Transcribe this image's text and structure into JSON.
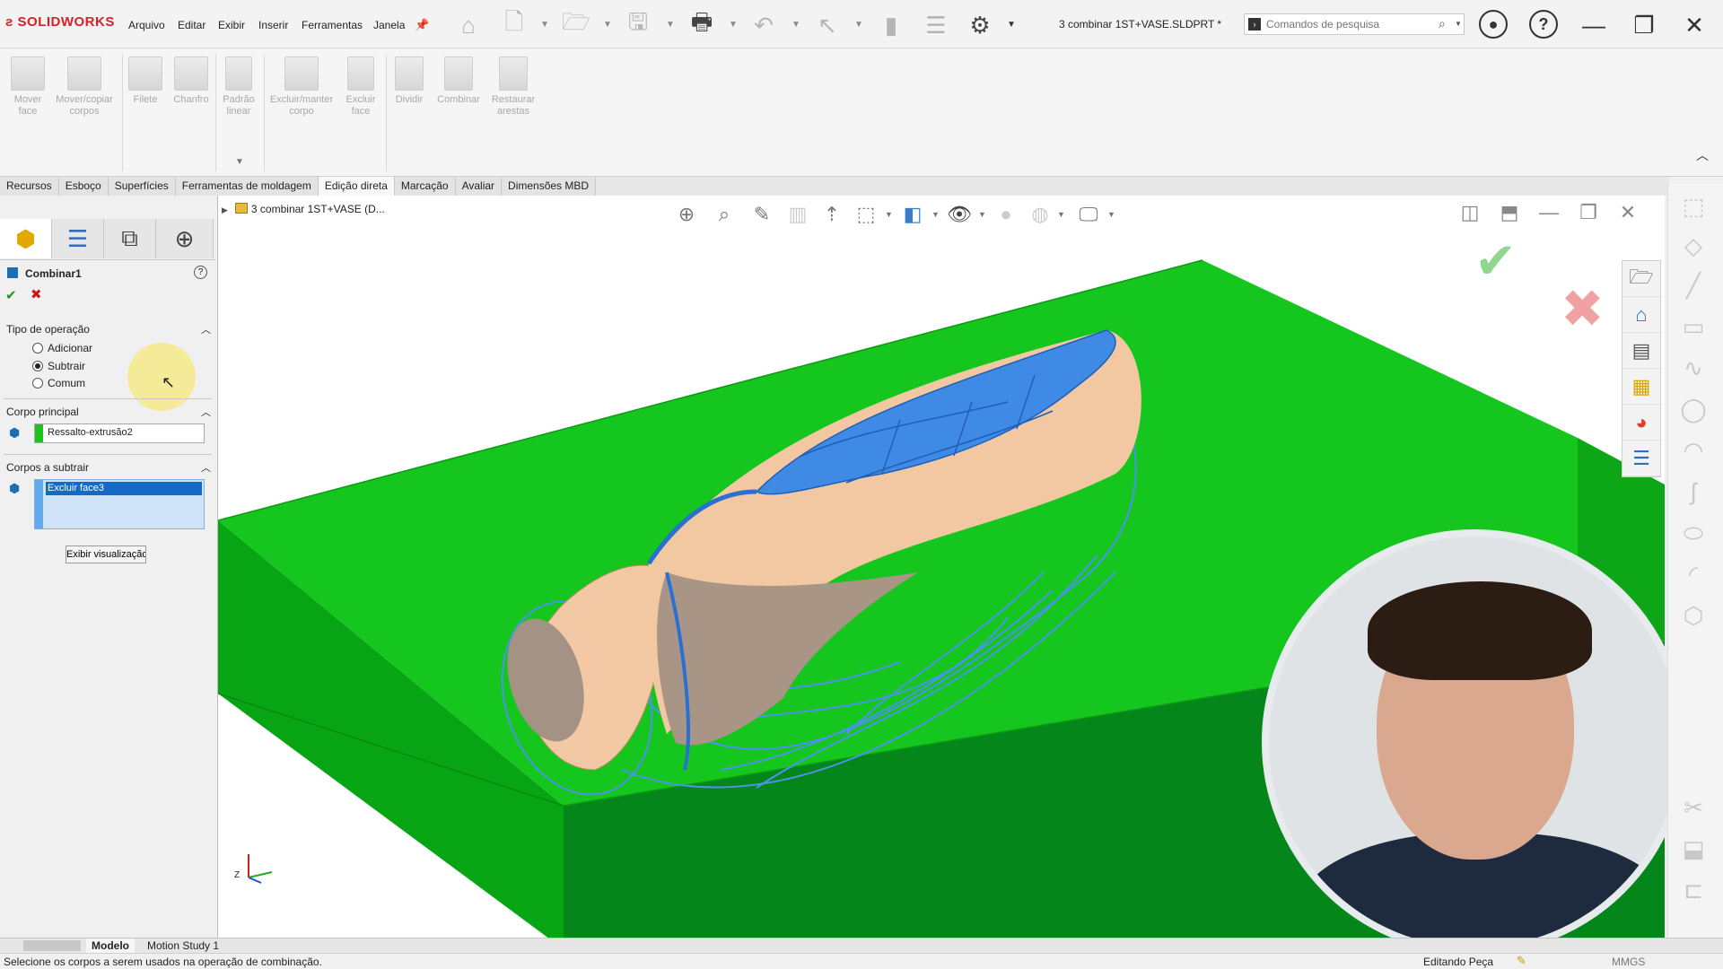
{
  "app": {
    "logo": "SOLIDWORKS",
    "document_title": "3 combinar 1ST+VASE.SLDPRT *"
  },
  "menu": [
    "Arquivo",
    "Editar",
    "Exibir",
    "Inserir",
    "Ferramentas",
    "Janela"
  ],
  "search": {
    "placeholder": "Comandos de pesquisa"
  },
  "ribbon": {
    "commands": [
      {
        "label": "Mover face"
      },
      {
        "label": "Mover/copiar corpos"
      },
      {
        "label": "Filete"
      },
      {
        "label": "Chanfro"
      },
      {
        "label": "Padrão linear"
      },
      {
        "label": "Excluir/manter corpo"
      },
      {
        "label": "Excluir face"
      },
      {
        "label": "Dividir"
      },
      {
        "label": "Combinar"
      },
      {
        "label": "Restaurar arestas"
      }
    ]
  },
  "tabs": [
    "Recursos",
    "Esboço",
    "Superfícies",
    "Ferramentas de moldagem",
    "Edição direta",
    "Marcação",
    "Avaliar",
    "Dimensões MBD"
  ],
  "active_tab": "Edição direta",
  "breadcrumb": "3 combinar 1ST+VASE  (D...",
  "property_manager": {
    "title": "Combinar1",
    "help": "?",
    "operation_group": {
      "title": "Tipo de operação",
      "options": [
        "Adicionar",
        "Subtrair",
        "Comum"
      ],
      "selected": "Subtrair"
    },
    "main_body_group": {
      "title": "Corpo principal",
      "value": "Ressalto-extrusão2"
    },
    "subtract_group": {
      "title": "Corpos a subtrair",
      "items": [
        "Excluir face3"
      ]
    },
    "preview_button": "Exibir visualização"
  },
  "bottom_tabs": [
    "Modelo",
    "Motion Study 1"
  ],
  "status": {
    "message": "Selecione os corpos a serem usados na operação de combinação.",
    "mode": "Editando Peça",
    "units": "MMGS"
  },
  "triad_label": "Z",
  "colors": {
    "block_top": "#10c319",
    "block_left": "#0aa313",
    "block_front": "#07731b",
    "vase_blue": "#3d8ae5",
    "vase_skin": "#f0c8a4",
    "accent_red": "#d6202a"
  },
  "icons": {
    "home": "home-icon",
    "new": "new-document-icon",
    "open": "open-folder-icon",
    "save": "save-icon",
    "print": "print-icon",
    "undo": "undo-icon",
    "select": "cursor-icon",
    "options": "gear-icon",
    "user": "user-icon",
    "help": "help-icon",
    "minimize": "minimize-icon",
    "maximize": "maximize-icon",
    "close": "close-icon"
  }
}
